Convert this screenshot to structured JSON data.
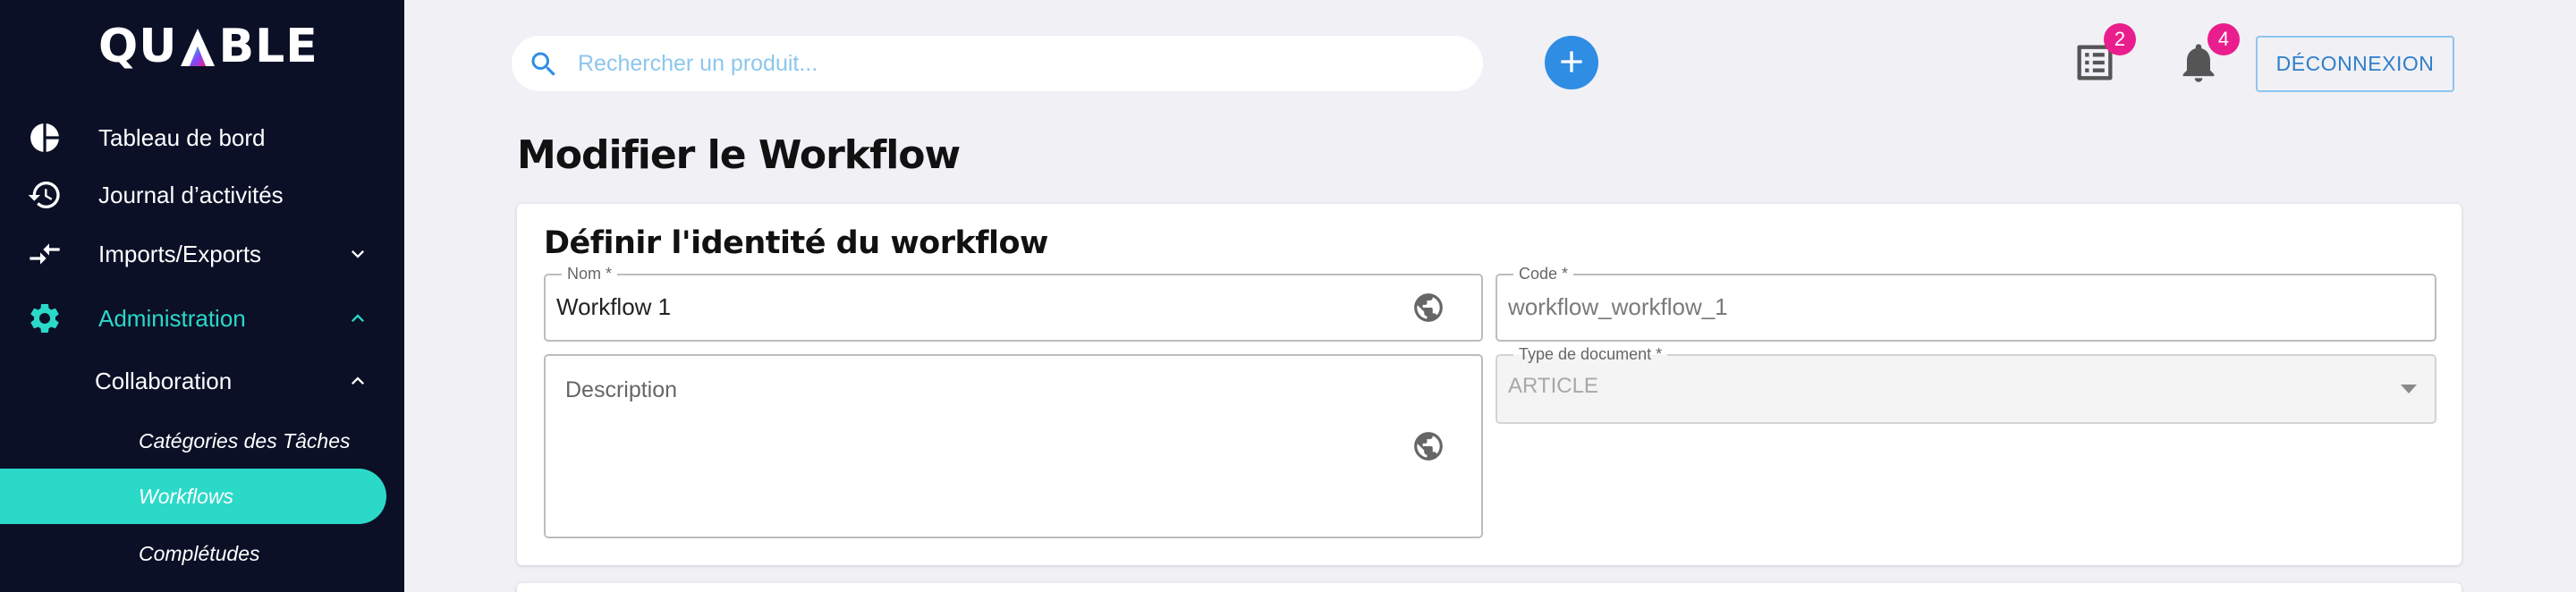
{
  "app": {
    "logo_text_left": "QU",
    "logo_text_right": "BLE"
  },
  "sidebar": {
    "items": [
      {
        "label": "Tableau de bord",
        "icon": "pie-chart-icon"
      },
      {
        "label": "Journal d’activités",
        "icon": "history-icon"
      },
      {
        "label": "Imports/Exports",
        "icon": "import-export-icon"
      },
      {
        "label": "Administration",
        "icon": "gear-icon"
      }
    ],
    "submenu": {
      "label": "Collaboration"
    },
    "leaves": [
      {
        "label": "Catégories des Tâches"
      },
      {
        "label": "Workflows"
      },
      {
        "label": "Complétudes"
      }
    ]
  },
  "topbar": {
    "search_placeholder": "Rechercher un produit...",
    "tasks_badge": "2",
    "notifications_badge": "4",
    "logout_label": "DÉCONNEXION"
  },
  "main": {
    "page_title": "Modifier le Workflow",
    "card_title": "Définir l'identité du workflow",
    "fields": {
      "name": {
        "label": "Nom *",
        "value": "Workflow 1"
      },
      "code": {
        "label": "Code *",
        "value": "workflow_workflow_1"
      },
      "description": {
        "placeholder": "Description"
      },
      "doc_type": {
        "label": "Type de document *",
        "value": "ARTICLE"
      }
    }
  },
  "colors": {
    "sidebar_bg": "#0b1027",
    "accent": "#2ad9c8",
    "badge": "#e91e8c",
    "primary": "#2f8de4"
  }
}
